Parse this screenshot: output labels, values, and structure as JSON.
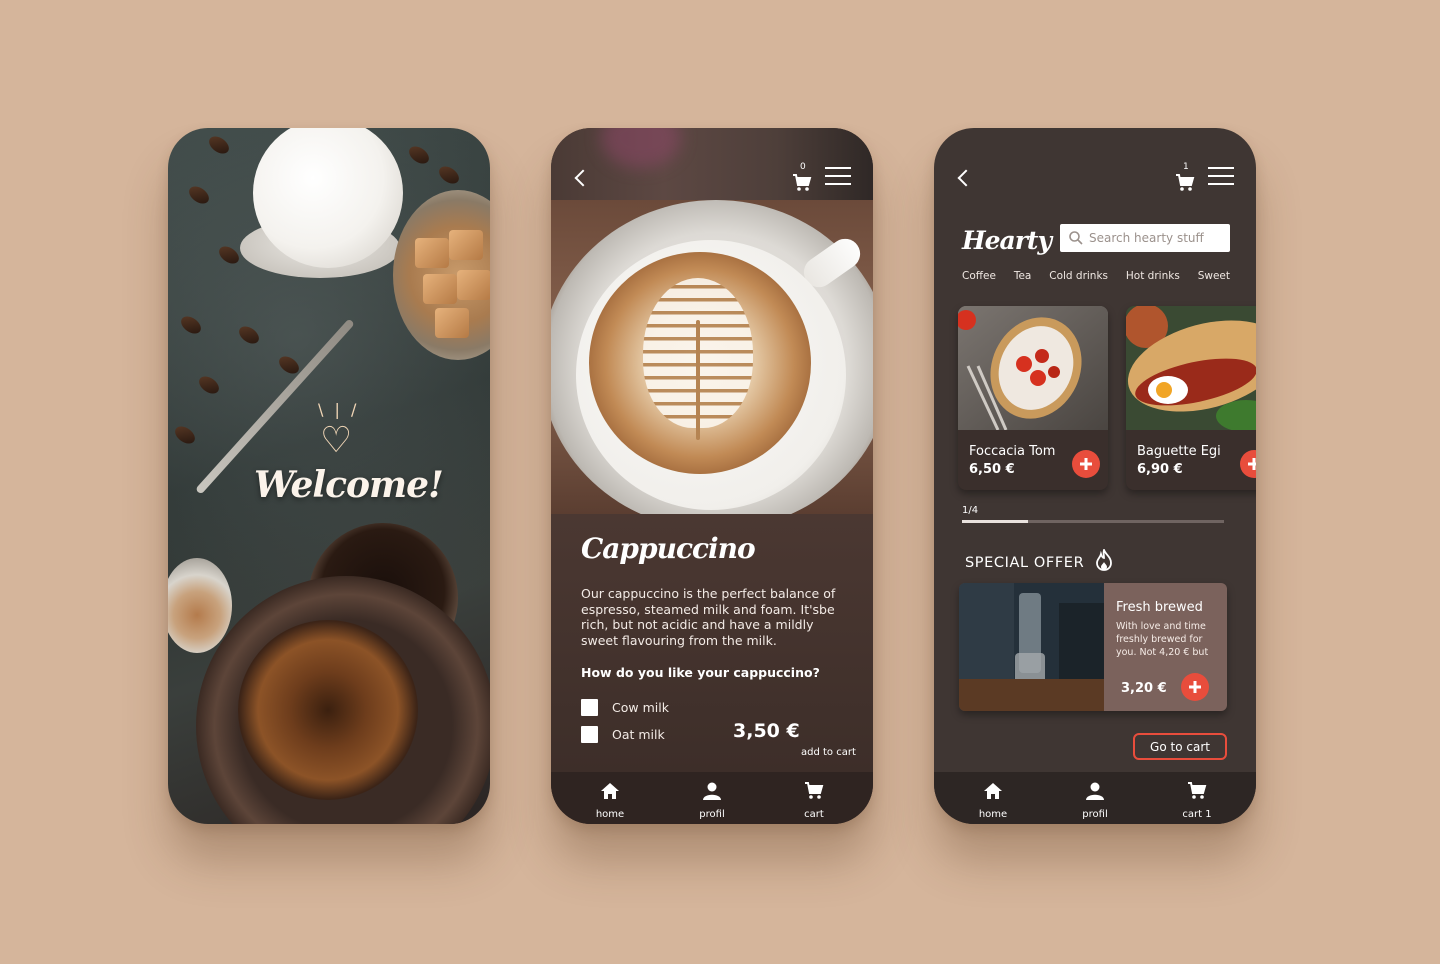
{
  "welcome": {
    "text": "Welcome!"
  },
  "product": {
    "cart_count": "0",
    "title": "Cappuccino",
    "description": "Our cappuccino is the perfect balance of espresso, steamed milk and foam. It'sbe rich, but not acidic and have a mildly sweet flavouring from the milk.",
    "question": "How do you like your cappuccino?",
    "options": [
      {
        "label": "Cow milk",
        "checked": false
      },
      {
        "label": "Oat milk",
        "checked": false
      }
    ],
    "price": "3,50 €",
    "add_to_cart": "add to cart"
  },
  "menu": {
    "cart_count": "1",
    "brand": "Hearty",
    "search_placeholder": "Search hearty stuff",
    "categories": [
      "Coffee",
      "Tea",
      "Cold drinks",
      "Hot drinks",
      "Sweet"
    ],
    "items": [
      {
        "name": "Foccacia Tom",
        "price": "6,50 €"
      },
      {
        "name": "Baguette Egi",
        "price": "6,90 €"
      }
    ],
    "pager": {
      "label": "1/4",
      "progress": 0.25
    },
    "special_offer": {
      "title": "SPECIAL OFFER",
      "name": "Fresh brewed",
      "description": "With love and time freshly brewed for you. Not 4,20 € but",
      "price": "3,20 €"
    },
    "go_to_cart": "Go to cart"
  },
  "nav": {
    "home": "home",
    "profil": "profil",
    "cart": "cart",
    "cart_with_count": "cart 1"
  },
  "colors": {
    "background": "#d5b59b",
    "accent": "#e84d3c",
    "panel_dark": "#3f3633"
  },
  "icons": {
    "back": "chevron-left-icon",
    "cart": "cart-icon",
    "menu": "hamburger-icon",
    "home": "home-icon",
    "profile": "user-icon",
    "search": "search-icon",
    "add": "plus-icon",
    "fire": "flame-icon",
    "heart": "heart-icon"
  }
}
